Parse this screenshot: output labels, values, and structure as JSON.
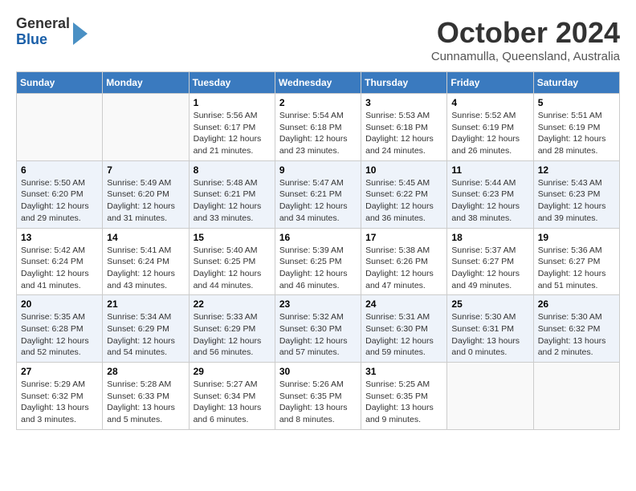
{
  "header": {
    "logo": {
      "general": "General",
      "blue": "Blue"
    },
    "title": "October 2024",
    "location": "Cunnamulla, Queensland, Australia"
  },
  "calendar": {
    "days_of_week": [
      "Sunday",
      "Monday",
      "Tuesday",
      "Wednesday",
      "Thursday",
      "Friday",
      "Saturday"
    ],
    "weeks": [
      [
        {
          "day": "",
          "info": ""
        },
        {
          "day": "",
          "info": ""
        },
        {
          "day": "1",
          "info": "Sunrise: 5:56 AM\nSunset: 6:17 PM\nDaylight: 12 hours\nand 21 minutes."
        },
        {
          "day": "2",
          "info": "Sunrise: 5:54 AM\nSunset: 6:18 PM\nDaylight: 12 hours\nand 23 minutes."
        },
        {
          "day": "3",
          "info": "Sunrise: 5:53 AM\nSunset: 6:18 PM\nDaylight: 12 hours\nand 24 minutes."
        },
        {
          "day": "4",
          "info": "Sunrise: 5:52 AM\nSunset: 6:19 PM\nDaylight: 12 hours\nand 26 minutes."
        },
        {
          "day": "5",
          "info": "Sunrise: 5:51 AM\nSunset: 6:19 PM\nDaylight: 12 hours\nand 28 minutes."
        }
      ],
      [
        {
          "day": "6",
          "info": "Sunrise: 5:50 AM\nSunset: 6:20 PM\nDaylight: 12 hours\nand 29 minutes."
        },
        {
          "day": "7",
          "info": "Sunrise: 5:49 AM\nSunset: 6:20 PM\nDaylight: 12 hours\nand 31 minutes."
        },
        {
          "day": "8",
          "info": "Sunrise: 5:48 AM\nSunset: 6:21 PM\nDaylight: 12 hours\nand 33 minutes."
        },
        {
          "day": "9",
          "info": "Sunrise: 5:47 AM\nSunset: 6:21 PM\nDaylight: 12 hours\nand 34 minutes."
        },
        {
          "day": "10",
          "info": "Sunrise: 5:45 AM\nSunset: 6:22 PM\nDaylight: 12 hours\nand 36 minutes."
        },
        {
          "day": "11",
          "info": "Sunrise: 5:44 AM\nSunset: 6:23 PM\nDaylight: 12 hours\nand 38 minutes."
        },
        {
          "day": "12",
          "info": "Sunrise: 5:43 AM\nSunset: 6:23 PM\nDaylight: 12 hours\nand 39 minutes."
        }
      ],
      [
        {
          "day": "13",
          "info": "Sunrise: 5:42 AM\nSunset: 6:24 PM\nDaylight: 12 hours\nand 41 minutes."
        },
        {
          "day": "14",
          "info": "Sunrise: 5:41 AM\nSunset: 6:24 PM\nDaylight: 12 hours\nand 43 minutes."
        },
        {
          "day": "15",
          "info": "Sunrise: 5:40 AM\nSunset: 6:25 PM\nDaylight: 12 hours\nand 44 minutes."
        },
        {
          "day": "16",
          "info": "Sunrise: 5:39 AM\nSunset: 6:25 PM\nDaylight: 12 hours\nand 46 minutes."
        },
        {
          "day": "17",
          "info": "Sunrise: 5:38 AM\nSunset: 6:26 PM\nDaylight: 12 hours\nand 47 minutes."
        },
        {
          "day": "18",
          "info": "Sunrise: 5:37 AM\nSunset: 6:27 PM\nDaylight: 12 hours\nand 49 minutes."
        },
        {
          "day": "19",
          "info": "Sunrise: 5:36 AM\nSunset: 6:27 PM\nDaylight: 12 hours\nand 51 minutes."
        }
      ],
      [
        {
          "day": "20",
          "info": "Sunrise: 5:35 AM\nSunset: 6:28 PM\nDaylight: 12 hours\nand 52 minutes."
        },
        {
          "day": "21",
          "info": "Sunrise: 5:34 AM\nSunset: 6:29 PM\nDaylight: 12 hours\nand 54 minutes."
        },
        {
          "day": "22",
          "info": "Sunrise: 5:33 AM\nSunset: 6:29 PM\nDaylight: 12 hours\nand 56 minutes."
        },
        {
          "day": "23",
          "info": "Sunrise: 5:32 AM\nSunset: 6:30 PM\nDaylight: 12 hours\nand 57 minutes."
        },
        {
          "day": "24",
          "info": "Sunrise: 5:31 AM\nSunset: 6:30 PM\nDaylight: 12 hours\nand 59 minutes."
        },
        {
          "day": "25",
          "info": "Sunrise: 5:30 AM\nSunset: 6:31 PM\nDaylight: 13 hours\nand 0 minutes."
        },
        {
          "day": "26",
          "info": "Sunrise: 5:30 AM\nSunset: 6:32 PM\nDaylight: 13 hours\nand 2 minutes."
        }
      ],
      [
        {
          "day": "27",
          "info": "Sunrise: 5:29 AM\nSunset: 6:32 PM\nDaylight: 13 hours\nand 3 minutes."
        },
        {
          "day": "28",
          "info": "Sunrise: 5:28 AM\nSunset: 6:33 PM\nDaylight: 13 hours\nand 5 minutes."
        },
        {
          "day": "29",
          "info": "Sunrise: 5:27 AM\nSunset: 6:34 PM\nDaylight: 13 hours\nand 6 minutes."
        },
        {
          "day": "30",
          "info": "Sunrise: 5:26 AM\nSunset: 6:35 PM\nDaylight: 13 hours\nand 8 minutes."
        },
        {
          "day": "31",
          "info": "Sunrise: 5:25 AM\nSunset: 6:35 PM\nDaylight: 13 hours\nand 9 minutes."
        },
        {
          "day": "",
          "info": ""
        },
        {
          "day": "",
          "info": ""
        }
      ]
    ]
  }
}
